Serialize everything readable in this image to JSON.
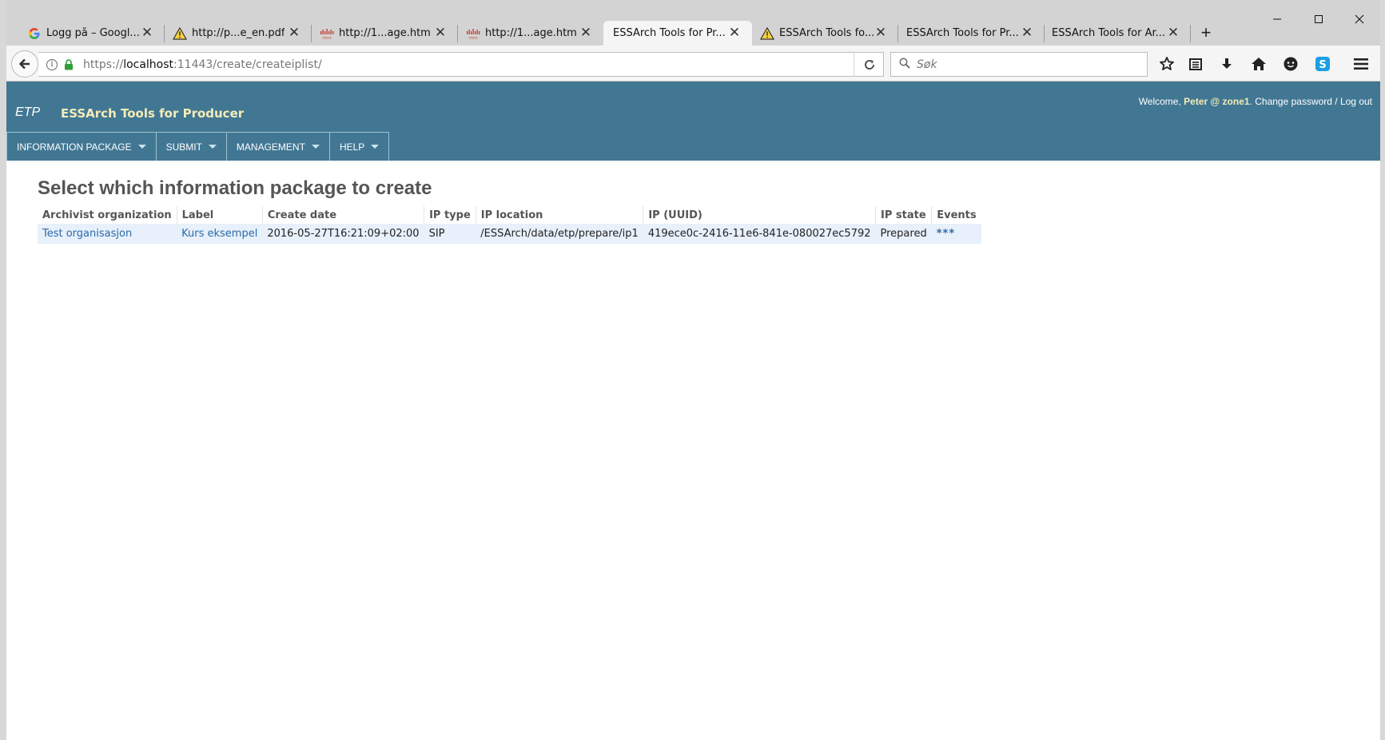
{
  "browser": {
    "tabs": [
      {
        "label": "Logg på – Googl...",
        "icon": "google-icon"
      },
      {
        "label": "http://p...e_en.pdf",
        "icon": "warning-icon"
      },
      {
        "label": "http://1...age.htm",
        "icon": "cisco-icon"
      },
      {
        "label": "http://1...age.htm",
        "icon": "cisco-icon"
      },
      {
        "label": "ESSArch Tools for Pr...",
        "icon": "",
        "active": true
      },
      {
        "label": "ESSArch Tools fo...",
        "icon": "warning-icon"
      },
      {
        "label": "ESSArch Tools for Pr...",
        "icon": ""
      },
      {
        "label": "ESSArch Tools for Ar...",
        "icon": ""
      }
    ],
    "new_tab": "+",
    "url_prefix": "https://",
    "url_host": "localhost",
    "url_rest": ":11443/create/createiplist/",
    "search_placeholder": "Søk",
    "accent_colors": {
      "skype": "#1a9fe3"
    }
  },
  "app": {
    "brand_short": "ETP",
    "brand_long": "ESSArch Tools for Producer",
    "welcome_prefix": "Welcome, ",
    "user": "Peter @ zone1",
    "user_links": ". Change password / Log out",
    "header_color": "#417793",
    "menu": [
      {
        "label": "INFORMATION PACKAGE"
      },
      {
        "label": "SUBMIT"
      },
      {
        "label": "MANAGEMENT"
      },
      {
        "label": "HELP"
      }
    ],
    "page_title": "Select which information package to create",
    "table": {
      "columns": [
        "Archivist organization",
        "Label",
        "Create date",
        "IP type",
        "IP location",
        "IP (UUID)",
        "IP state",
        "Events"
      ],
      "rows": [
        {
          "archivist_organization": "Test organisasjon",
          "label": "Kurs eksempel",
          "create_date": "2016-05-27T16:21:09+02:00",
          "ip_type": "SIP",
          "ip_location": "/ESSArch/data/etp/prepare/ip1",
          "ip_uuid": "419ece0c-2416-11e6-841e-080027ec5792",
          "ip_state": "Prepared",
          "events": "***"
        }
      ]
    }
  }
}
